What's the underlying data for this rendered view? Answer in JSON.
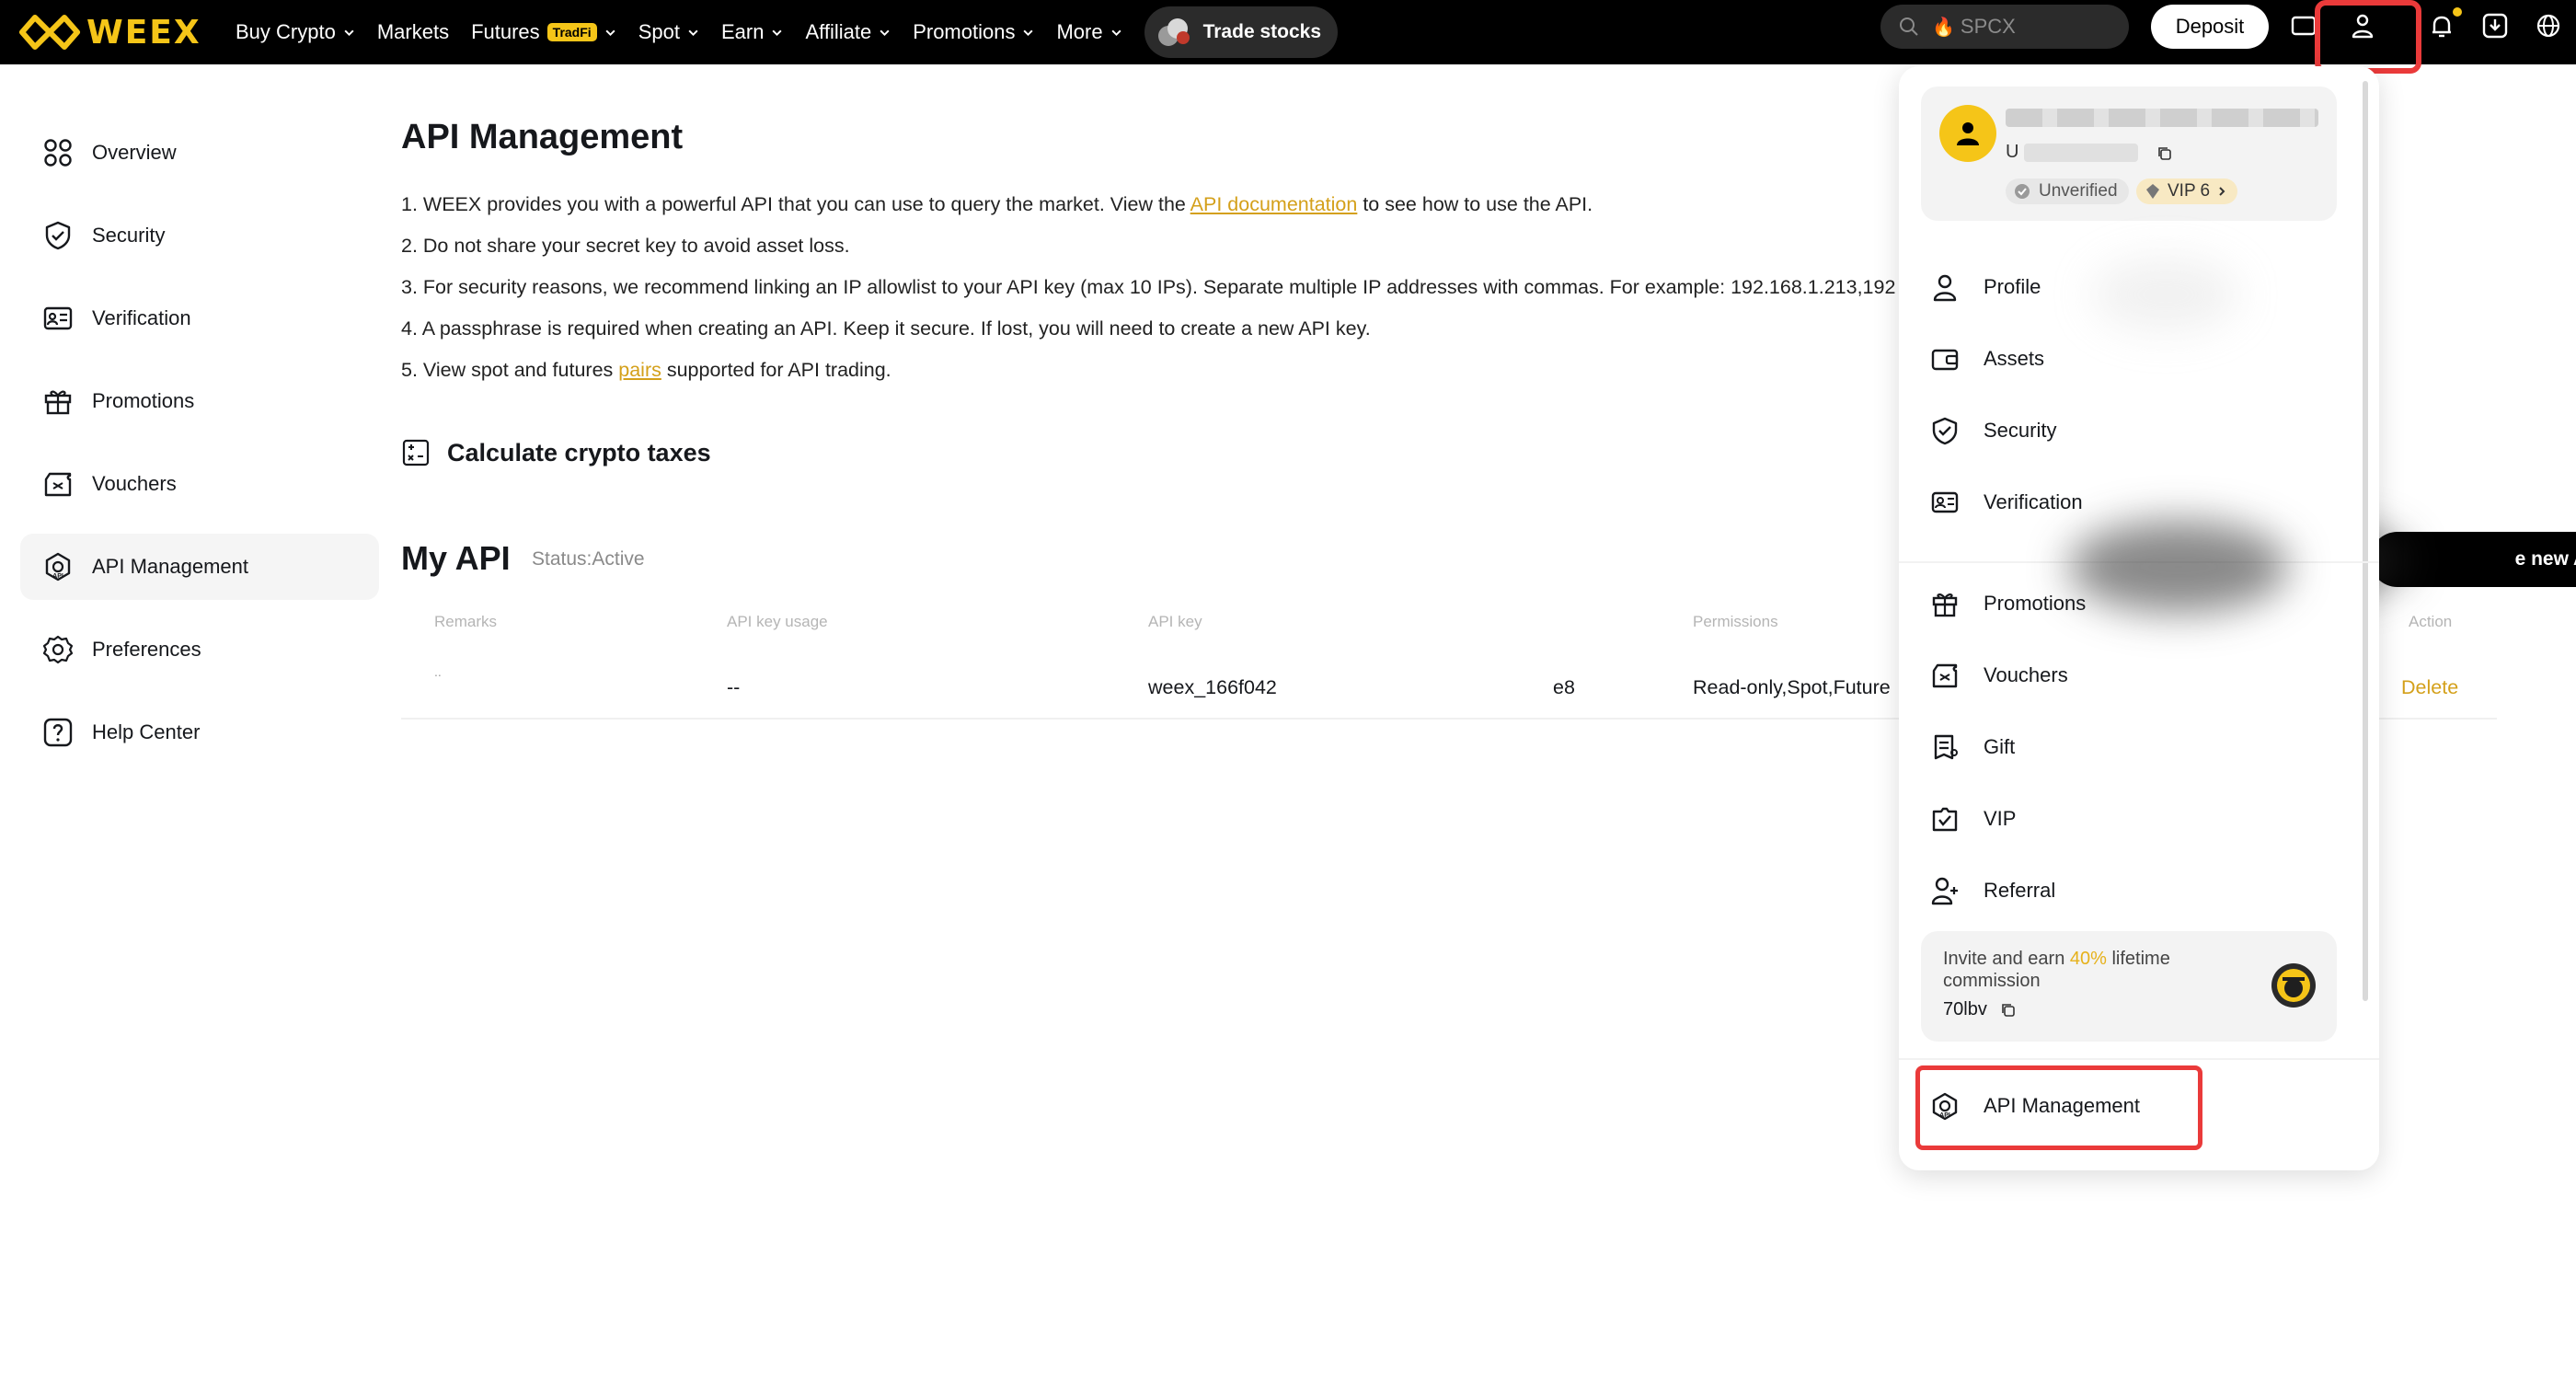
{
  "brand": {
    "name": "WEEX",
    "accent": "#f5c518",
    "highlight": "#ea3a3a"
  },
  "nav": {
    "buy_crypto": "Buy Crypto",
    "markets": "Markets",
    "futures": "Futures",
    "futures_badge": "TradFi",
    "spot": "Spot",
    "earn": "Earn",
    "affiliate": "Affiliate",
    "promotions": "Promotions",
    "more": "More",
    "trade_stocks": "Trade stocks"
  },
  "search": {
    "placeholder": "SPCX"
  },
  "header": {
    "deposit_label": "Deposit"
  },
  "sidebar": {
    "items": [
      {
        "label": "Overview",
        "icon": "overview-icon"
      },
      {
        "label": "Security",
        "icon": "shield-icon"
      },
      {
        "label": "Verification",
        "icon": "id-card-icon"
      },
      {
        "label": "Promotions",
        "icon": "gift-icon"
      },
      {
        "label": "Vouchers",
        "icon": "voucher-icon"
      },
      {
        "label": "API Management",
        "icon": "api-icon"
      },
      {
        "label": "Preferences",
        "icon": "gear-icon"
      },
      {
        "label": "Help Center",
        "icon": "help-icon"
      }
    ],
    "active": "API Management"
  },
  "main": {
    "title": "API Management",
    "notes": {
      "n1_prefix": "1. WEEX provides you with a powerful API that you can use to query the market. View the ",
      "n1_link": "API documentation",
      "n1_suffix": " to see how to use the API.",
      "n2": "2. Do not share your secret key to avoid asset loss.",
      "n3": "3. For security reasons, we recommend linking an IP allowlist to your API key (max 10 IPs). Separate multiple IP addresses with commas. For example: 192.168.1.213,192",
      "n4": "4. A passphrase is required when creating an API. Keep it secure. If lost, you will need to create a new API key.",
      "n5_prefix": "5. View spot and futures ",
      "n5_link": "pairs",
      "n5_suffix": " supported for API trading."
    },
    "calc_taxes": "Calculate crypto taxes",
    "my_api": "My API",
    "status": "Status:Active",
    "create_button": "e new API",
    "table": {
      "headers": {
        "remarks": "Remarks",
        "usage": "API key usage",
        "key": "API key",
        "permissions": "Permissions",
        "action": "Action"
      },
      "row": {
        "remarks": "..",
        "usage": "--",
        "key_start": "weex_166f042",
        "key_end": "e8",
        "permissions": "Read-only,Spot,Future",
        "action": "Delete"
      }
    }
  },
  "dropdown": {
    "uid_prefix": "U",
    "unverified": "Unverified",
    "vip": "VIP 6",
    "items": {
      "profile": "Profile",
      "assets": "Assets",
      "security": "Security",
      "verification": "Verification",
      "promotions": "Promotions",
      "vouchers": "Vouchers",
      "gift": "Gift",
      "vip": "VIP",
      "referral": "Referral",
      "api_management": "API Management"
    },
    "invite": {
      "prefix": "Invite and earn ",
      "percent": "40%",
      "suffix": " lifetime commission",
      "code": "70lbv"
    }
  }
}
